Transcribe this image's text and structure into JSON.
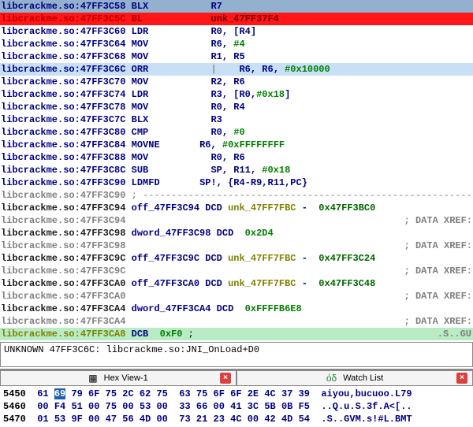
{
  "disasm": {
    "lines": [
      {
        "bg": "bg-blue",
        "loccls": "loc-navy",
        "loc": "libcrackme.so:47FF3C58",
        "mn": "BLX",
        "mncls": "mn-navy",
        "ops": [
          {
            "t": "R7",
            "c": "op-navy"
          }
        ],
        "pad": 14
      },
      {
        "bg": "bg-red",
        "loccls": "loc-red",
        "loc": "libcrackme.so:47FF3C5C",
        "mn": "BL",
        "mncls": "mn-red",
        "ops": [
          {
            "t": "unk_47FF37F4",
            "c": "op-darkred"
          }
        ],
        "pad": 14
      },
      {
        "bg": "",
        "loccls": "loc-navy",
        "loc": "libcrackme.so:47FF3C60",
        "mn": "LDR",
        "mncls": "mn-navy",
        "ops": [
          {
            "t": "R0, ",
            "c": "op-navy"
          },
          {
            "t": "[R4]",
            "c": "op-navy"
          }
        ],
        "pad": 14
      },
      {
        "bg": "",
        "loccls": "loc-navy",
        "loc": "libcrackme.so:47FF3C64",
        "mn": "MOV",
        "mncls": "mn-navy",
        "ops": [
          {
            "t": "R6, ",
            "c": "op-navy"
          },
          {
            "t": "#4",
            "c": "op-green"
          }
        ],
        "pad": 14
      },
      {
        "bg": "",
        "loccls": "loc-navy",
        "loc": "libcrackme.so:47FF3C68",
        "mn": "MOV",
        "mncls": "mn-navy",
        "ops": [
          {
            "t": "R1, R5",
            "c": "op-navy"
          }
        ],
        "pad": 14
      },
      {
        "bg": "bg-light",
        "loccls": "loc-navy",
        "loc": "libcrackme.so:47FF3C6C",
        "mn": "ORR",
        "mncls": "mn-navy",
        "cursor": true,
        "ops": [
          {
            "t": "R6, R6, ",
            "c": "op-navy"
          },
          {
            "t": "#0x10000",
            "c": "op-green"
          }
        ],
        "pad": 14
      },
      {
        "bg": "",
        "loccls": "loc-navy",
        "loc": "libcrackme.so:47FF3C70",
        "mn": "MOV",
        "mncls": "mn-navy",
        "ops": [
          {
            "t": "R2, R6",
            "c": "op-navy"
          }
        ],
        "pad": 14
      },
      {
        "bg": "",
        "loccls": "loc-navy",
        "loc": "libcrackme.so:47FF3C74",
        "mn": "LDR",
        "mncls": "mn-navy",
        "ops": [
          {
            "t": "R3, ",
            "c": "op-navy"
          },
          {
            "t": "[R0,",
            "c": "op-navy"
          },
          {
            "t": "#0x18",
            "c": "op-green"
          },
          {
            "t": "]",
            "c": "op-navy"
          }
        ],
        "pad": 14
      },
      {
        "bg": "",
        "loccls": "loc-navy",
        "loc": "libcrackme.so:47FF3C78",
        "mn": "MOV",
        "mncls": "mn-navy",
        "ops": [
          {
            "t": "R0, R4",
            "c": "op-navy"
          }
        ],
        "pad": 14
      },
      {
        "bg": "",
        "loccls": "loc-navy",
        "loc": "libcrackme.so:47FF3C7C",
        "mn": "BLX",
        "mncls": "mn-navy",
        "ops": [
          {
            "t": "R3",
            "c": "op-navy"
          }
        ],
        "pad": 14
      },
      {
        "bg": "",
        "loccls": "loc-navy",
        "loc": "libcrackme.so:47FF3C80",
        "mn": "CMP",
        "mncls": "mn-navy",
        "ops": [
          {
            "t": "R0, ",
            "c": "op-navy"
          },
          {
            "t": "#0",
            "c": "op-green"
          }
        ],
        "pad": 14
      },
      {
        "bg": "",
        "loccls": "loc-navy",
        "loc": "libcrackme.so:47FF3C84",
        "mn": "MOVNE",
        "mncls": "mn-navy",
        "ops": [
          {
            "t": "R6, ",
            "c": "op-navy"
          },
          {
            "t": "#0xFFFFFFFF",
            "c": "op-green"
          }
        ],
        "pad": 12
      },
      {
        "bg": "",
        "loccls": "loc-navy",
        "loc": "libcrackme.so:47FF3C88",
        "mn": "MOV",
        "mncls": "mn-navy",
        "ops": [
          {
            "t": "R0, R6",
            "c": "op-navy"
          }
        ],
        "pad": 14
      },
      {
        "bg": "",
        "loccls": "loc-navy",
        "loc": "libcrackme.so:47FF3C8C",
        "mn": "SUB",
        "mncls": "mn-navy",
        "ops": [
          {
            "t": "SP, R11, ",
            "c": "op-navy"
          },
          {
            "t": "#0x18",
            "c": "op-green"
          }
        ],
        "pad": 14
      },
      {
        "bg": "",
        "loccls": "loc-navy",
        "loc": "libcrackme.so:47FF3C90",
        "mn": "LDMFD",
        "mncls": "mn-navy",
        "ops": [
          {
            "t": "SP!, {R4-R9,R11,PC}",
            "c": "op-navy"
          }
        ],
        "pad": 12
      },
      {
        "bg": "",
        "loccls": "loc-gray",
        "loc": "libcrackme.so:47FF3C90",
        "raw": " ; ---------------------------------------------------------------------------",
        "rawcls": "dashline"
      },
      {
        "bg": "",
        "loccls": "loc-dark",
        "loc": "libcrackme.so:47FF3C94",
        "postloc": true,
        "ops": [
          {
            "t": "off_47FF3C94 ",
            "c": "op-navy"
          },
          {
            "t": "DCD ",
            "c": "op-navy"
          },
          {
            "t": "unk_47FF7FBC ",
            "c": "op-olive"
          },
          {
            "t": "- ",
            "c": "op-navy"
          },
          {
            "t": " 0x47FF3BC0",
            "c": "op-dgreen"
          }
        ]
      },
      {
        "bg": "",
        "loccls": "loc-gray",
        "loc": "libcrackme.so:47FF3C94",
        "post2": true,
        "ops": [
          {
            "t": "; ",
            "c": "op-gray"
          },
          {
            "t": "DATA XREF:",
            "c": "op-gray"
          }
        ]
      },
      {
        "bg": "",
        "loccls": "loc-dark",
        "loc": "libcrackme.so:47FF3C98",
        "postloc": true,
        "ops": [
          {
            "t": "dword_47FF3C98 ",
            "c": "op-navy"
          },
          {
            "t": "DCD ",
            "c": "op-navy"
          },
          {
            "t": " 0x2D4",
            "c": "op-green"
          }
        ]
      },
      {
        "bg": "",
        "loccls": "loc-gray",
        "loc": "libcrackme.so:47FF3C98",
        "post2": true,
        "ops": [
          {
            "t": "; ",
            "c": "op-gray"
          },
          {
            "t": "DATA XREF:",
            "c": "op-gray"
          }
        ]
      },
      {
        "bg": "",
        "loccls": "loc-dark",
        "loc": "libcrackme.so:47FF3C9C",
        "postloc": true,
        "ops": [
          {
            "t": "off_47FF3C9C ",
            "c": "op-navy"
          },
          {
            "t": "DCD ",
            "c": "op-navy"
          },
          {
            "t": "unk_47FF7FBC ",
            "c": "op-olive"
          },
          {
            "t": "- ",
            "c": "op-navy"
          },
          {
            "t": " 0x47FF3C24",
            "c": "op-dgreen"
          }
        ]
      },
      {
        "bg": "",
        "loccls": "loc-gray",
        "loc": "libcrackme.so:47FF3C9C",
        "post2": true,
        "ops": [
          {
            "t": "; ",
            "c": "op-gray"
          },
          {
            "t": "DATA XREF:",
            "c": "op-gray"
          }
        ]
      },
      {
        "bg": "",
        "loccls": "loc-dark",
        "loc": "libcrackme.so:47FF3CA0",
        "postloc": true,
        "ops": [
          {
            "t": "off_47FF3CA0 ",
            "c": "op-navy"
          },
          {
            "t": "DCD ",
            "c": "op-navy"
          },
          {
            "t": "unk_47FF7FBC ",
            "c": "op-olive"
          },
          {
            "t": "- ",
            "c": "op-navy"
          },
          {
            "t": " 0x47FF3C48",
            "c": "op-dgreen"
          }
        ]
      },
      {
        "bg": "",
        "loccls": "loc-gray",
        "loc": "libcrackme.so:47FF3CA0",
        "post2": true,
        "ops": [
          {
            "t": "; ",
            "c": "op-gray"
          },
          {
            "t": "DATA XREF:",
            "c": "op-gray"
          }
        ]
      },
      {
        "bg": "",
        "loccls": "loc-dark",
        "loc": "libcrackme.so:47FF3CA4",
        "postloc": true,
        "ops": [
          {
            "t": "dword_47FF3CA4 ",
            "c": "op-navy"
          },
          {
            "t": "DCD ",
            "c": "op-navy"
          },
          {
            "t": " 0xFFFFB6E8",
            "c": "op-green"
          }
        ]
      },
      {
        "bg": "",
        "loccls": "loc-gray",
        "loc": "libcrackme.so:47FF3CA4",
        "post2": true,
        "ops": [
          {
            "t": "; ",
            "c": "op-gray"
          },
          {
            "t": "DATA XREF:",
            "c": "op-gray"
          }
        ]
      },
      {
        "bg": "bg-green",
        "loccls": "loc-olive",
        "loc": "libcrackme.so:47FF3CA8",
        "postloc": true,
        "ops": [
          {
            "t": "DCB ",
            "c": "op-navy"
          },
          {
            "t": " 0xF0",
            "c": "op-green"
          },
          {
            "t": " ;",
            "c": "op-black"
          },
          {
            "t": "  .S..GU",
            "c": "op-gray",
            "tail": true
          }
        ]
      }
    ]
  },
  "status": "UNKNOWN 47FF3C6C: libcrackme.so:JNI_OnLoad+D0",
  "tabs": {
    "hex": "Hex View-1",
    "watch": "Watch List"
  },
  "hex": {
    "rows": [
      {
        "addr": "5450",
        "sel": 1,
        "bytes": [
          "61",
          "69",
          "79",
          "6F",
          "75",
          "2C",
          "62",
          "75",
          "63",
          "75",
          "6F",
          "6F",
          "2E",
          "4C",
          "37",
          "39"
        ],
        "ascii": "aiyou,bucuoo.L79"
      },
      {
        "addr": "5460",
        "sel": -1,
        "bytes": [
          "00",
          "F4",
          "51",
          "00",
          "75",
          "00",
          "53",
          "00",
          "33",
          "66",
          "00",
          "41",
          "3C",
          "5B",
          "0B",
          "F5"
        ],
        "ascii": "..Q.u.S.3f.A<[.."
      },
      {
        "addr": "5470",
        "sel": -1,
        "bytes": [
          "01",
          "53",
          "9F",
          "00",
          "47",
          "56",
          "4D",
          "00",
          "73",
          "21",
          "23",
          "4C",
          "00",
          "42",
          "4D",
          "54"
        ],
        "ascii": ".S..GVM.s!#L.BMT"
      }
    ]
  }
}
